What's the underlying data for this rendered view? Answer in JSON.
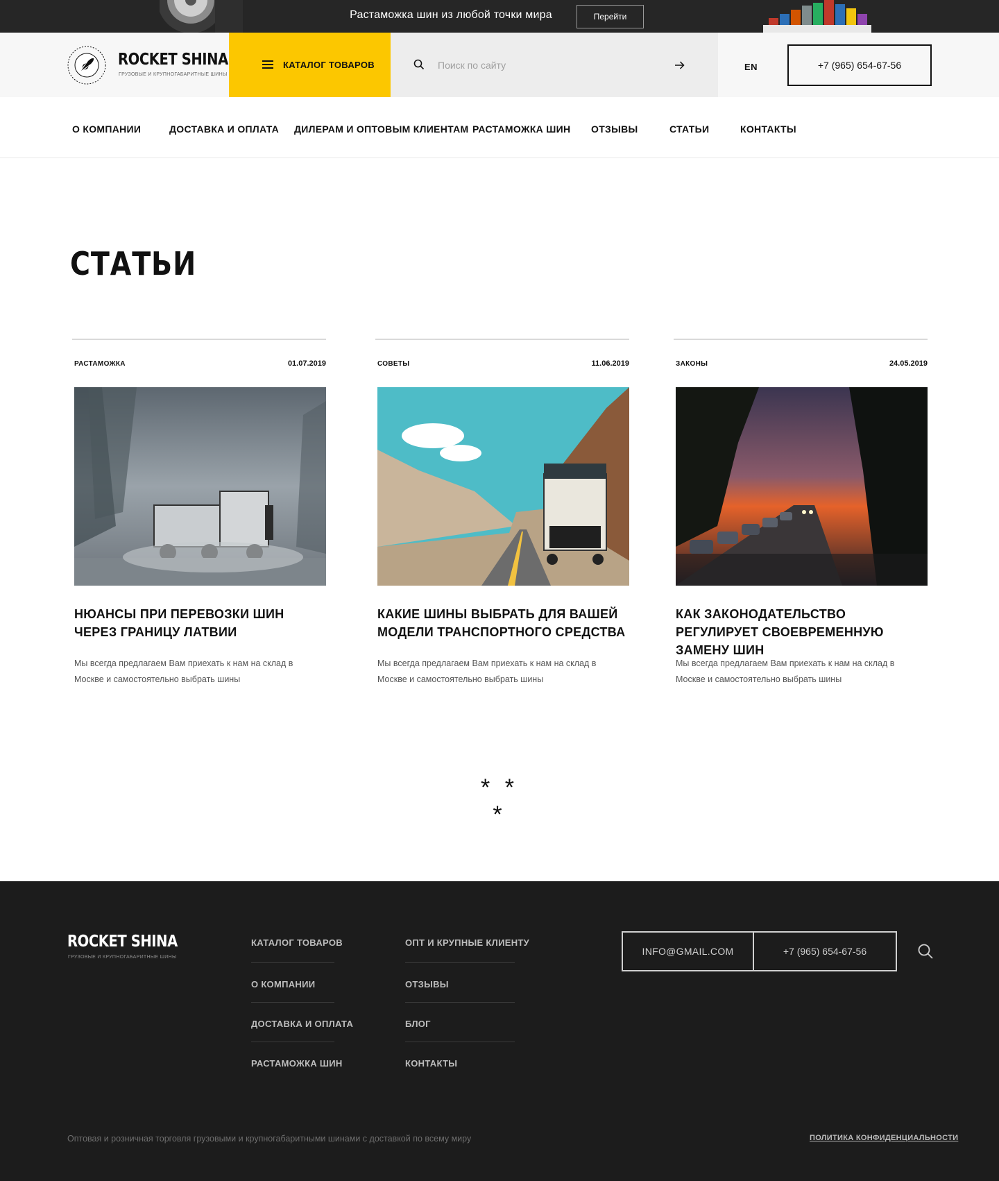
{
  "promo": {
    "text": "Растаможка шин из любой точки мира",
    "button_label": "Перейти"
  },
  "header": {
    "logo_title": "ROCKET SHINA",
    "logo_subtitle": "ГРУЗОВЫЕ И КРУПНОГАБАРИТНЫЕ ШИНЫ",
    "catalog_label": "КАТАЛОГ ТОВАРОВ",
    "search_placeholder": "Поиск по сайту",
    "lang": "EN",
    "phone": "+7 (965) 654-67-56"
  },
  "nav": {
    "items": [
      "О КОМПАНИИ",
      "ДОСТАВКА И ОПЛАТА",
      "ДИЛЕРАМ И ОПТОВЫМ КЛИЕНТАМ",
      "РАСТАМОЖКА ШИН",
      "ОТЗЫВЫ",
      "СТАТЬИ",
      "КОНТАКТЫ"
    ]
  },
  "page": {
    "title": "СТАТЬИ",
    "separator": "* * *"
  },
  "articles": [
    {
      "category": "РАСТАМОЖКА",
      "date": "01.07.2019",
      "title": "НЮАНСЫ ПРИ ПЕРЕВОЗКИ ШИН ЧЕРЕЗ ГРАНИЦУ ЛАТВИИ",
      "text": "Мы всегда предлагаем Вам приехать к нам на склад в Москве и самостоятельно выбрать шины"
    },
    {
      "category": "СОВЕТЫ",
      "date": "11.06.2019",
      "title": "КАКИЕ ШИНЫ ВЫБРАТЬ ДЛЯ ВАШЕЙ МОДЕЛИ ТРАНСПОРТНОГО СРЕДСТВА",
      "text": "Мы всегда предлагаем Вам приехать к нам на склад в Москве и самостоятельно выбрать шины"
    },
    {
      "category": "ЗАКОНЫ",
      "date": "24.05.2019",
      "title": "КАК ЗАКОНОДАТЕЛЬСТВО РЕГУЛИРУЕТ СВОЕВРЕМЕННУЮ ЗАМЕНУ ШИН",
      "text": "Мы всегда предлагаем Вам приехать к нам на склад в Москве и самостоятельно выбрать шины"
    }
  ],
  "footer": {
    "logo_title": "ROCKET SHINA",
    "logo_subtitle": "ГРУЗОВЫЕ И КРУПНОГАБАРИТНЫЕ ШИНЫ",
    "col1": [
      "КАТАЛОГ ТОВАРОВ",
      "О КОМПАНИИ",
      "ДОСТАВКА И ОПЛАТА",
      "РАСТАМОЖКА ШИН"
    ],
    "col2": [
      "ОПТ И КРУПНЫЕ КЛИЕНТУ",
      "ОТЗЫВЫ",
      "БЛОГ",
      "КОНТАКТЫ"
    ],
    "email": "INFO@GMAIL.COM",
    "phone": "+7 (965) 654-67-56",
    "copyright": "Оптовая и розничная торговля грузовыми и крупногабаритными шинами с доставкой по всему миру",
    "policy": "ПОЛИТИКА КОНФИДЕНЦИАЛЬНОСТИ"
  },
  "colors": {
    "accent": "#fcc700",
    "dark": "#1c1c1c",
    "banner": "#262626"
  },
  "icons": [
    "tire-image",
    "ship-image",
    "rocket-icon",
    "menu-icon",
    "search-icon",
    "arrow-right-icon"
  ]
}
